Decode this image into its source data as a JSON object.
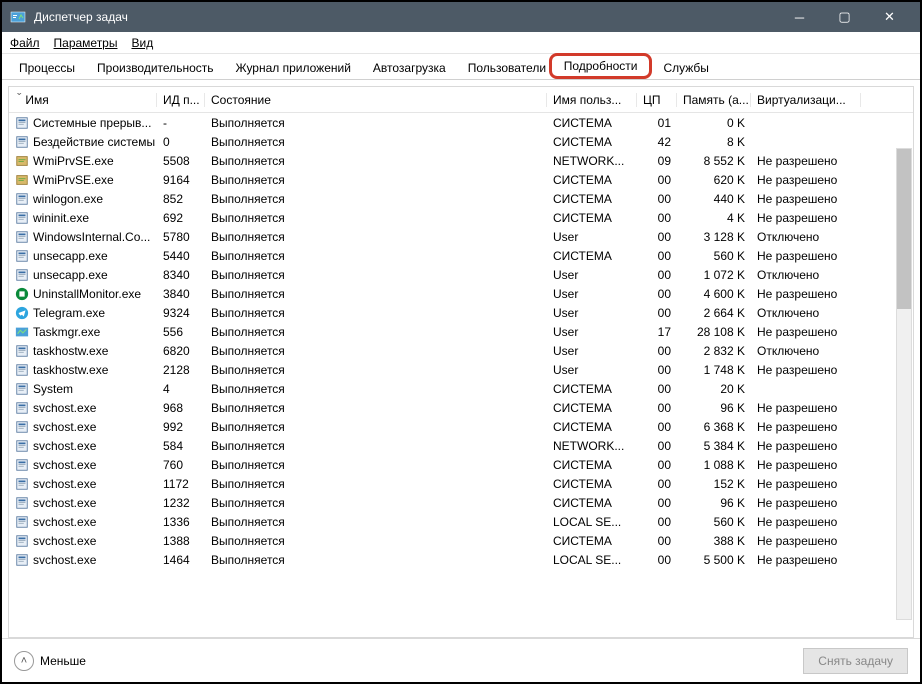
{
  "titlebar": {
    "title": "Диспетчер задач"
  },
  "menubar": {
    "file": "Файл",
    "options": "Параметры",
    "view": "Вид"
  },
  "tabs": {
    "processes": "Процессы",
    "performance": "Производительность",
    "apphistory": "Журнал приложений",
    "startup": "Автозагрузка",
    "users": "Пользователи",
    "details": "Подробности",
    "services": "Службы"
  },
  "columns": {
    "name": "Имя",
    "pid": "ИД п...",
    "state": "Состояние",
    "user": "Имя польз...",
    "cpu": "ЦП",
    "mem": "Память (а...",
    "virt": "Виртуализаци..."
  },
  "state_running": "Выполняется",
  "rows": [
    {
      "name": "Системные прерыв...",
      "pid": "-",
      "user": "СИСТЕМА",
      "cpu": "01",
      "mem": "0 K",
      "virt": "",
      "icon": "sys"
    },
    {
      "name": "Бездействие системы",
      "pid": "0",
      "user": "СИСТЕМА",
      "cpu": "42",
      "mem": "8 K",
      "virt": "",
      "icon": "sys"
    },
    {
      "name": "WmiPrvSE.exe",
      "pid": "5508",
      "user": "NETWORK...",
      "cpu": "09",
      "mem": "8 552 K",
      "virt": "Не разрешено",
      "icon": "wmi"
    },
    {
      "name": "WmiPrvSE.exe",
      "pid": "9164",
      "user": "СИСТЕМА",
      "cpu": "00",
      "mem": "620 K",
      "virt": "Не разрешено",
      "icon": "wmi"
    },
    {
      "name": "winlogon.exe",
      "pid": "852",
      "user": "СИСТЕМА",
      "cpu": "00",
      "mem": "440 K",
      "virt": "Не разрешено",
      "icon": "exe"
    },
    {
      "name": "wininit.exe",
      "pid": "692",
      "user": "СИСТЕМА",
      "cpu": "00",
      "mem": "4 K",
      "virt": "Не разрешено",
      "icon": "exe"
    },
    {
      "name": "WindowsInternal.Co...",
      "pid": "5780",
      "user": "User",
      "cpu": "00",
      "mem": "3 128 K",
      "virt": "Отключено",
      "icon": "exe"
    },
    {
      "name": "unsecapp.exe",
      "pid": "5440",
      "user": "СИСТЕМА",
      "cpu": "00",
      "mem": "560 K",
      "virt": "Не разрешено",
      "icon": "exe"
    },
    {
      "name": "unsecapp.exe",
      "pid": "8340",
      "user": "User",
      "cpu": "00",
      "mem": "1 072 K",
      "virt": "Отключено",
      "icon": "exe"
    },
    {
      "name": "UninstallMonitor.exe",
      "pid": "3840",
      "user": "User",
      "cpu": "00",
      "mem": "4 600 K",
      "virt": "Не разрешено",
      "icon": "green"
    },
    {
      "name": "Telegram.exe",
      "pid": "9324",
      "user": "User",
      "cpu": "00",
      "mem": "2 664 K",
      "virt": "Отключено",
      "icon": "telegram"
    },
    {
      "name": "Taskmgr.exe",
      "pid": "556",
      "user": "User",
      "cpu": "17",
      "mem": "28 108 K",
      "virt": "Не разрешено",
      "icon": "taskmgr"
    },
    {
      "name": "taskhostw.exe",
      "pid": "6820",
      "user": "User",
      "cpu": "00",
      "mem": "2 832 K",
      "virt": "Отключено",
      "icon": "exe"
    },
    {
      "name": "taskhostw.exe",
      "pid": "2128",
      "user": "User",
      "cpu": "00",
      "mem": "1 748 K",
      "virt": "Не разрешено",
      "icon": "exe"
    },
    {
      "name": "System",
      "pid": "4",
      "user": "СИСТЕМА",
      "cpu": "00",
      "mem": "20 K",
      "virt": "",
      "icon": "sys"
    },
    {
      "name": "svchost.exe",
      "pid": "968",
      "user": "СИСТЕМА",
      "cpu": "00",
      "mem": "96 K",
      "virt": "Не разрешено",
      "icon": "svc"
    },
    {
      "name": "svchost.exe",
      "pid": "992",
      "user": "СИСТЕМА",
      "cpu": "00",
      "mem": "6 368 K",
      "virt": "Не разрешено",
      "icon": "svc"
    },
    {
      "name": "svchost.exe",
      "pid": "584",
      "user": "NETWORK...",
      "cpu": "00",
      "mem": "5 384 K",
      "virt": "Не разрешено",
      "icon": "svc"
    },
    {
      "name": "svchost.exe",
      "pid": "760",
      "user": "СИСТЕМА",
      "cpu": "00",
      "mem": "1 088 K",
      "virt": "Не разрешено",
      "icon": "svc"
    },
    {
      "name": "svchost.exe",
      "pid": "1172",
      "user": "СИСТЕМА",
      "cpu": "00",
      "mem": "152 K",
      "virt": "Не разрешено",
      "icon": "svc"
    },
    {
      "name": "svchost.exe",
      "pid": "1232",
      "user": "СИСТЕМА",
      "cpu": "00",
      "mem": "96 K",
      "virt": "Не разрешено",
      "icon": "svc"
    },
    {
      "name": "svchost.exe",
      "pid": "1336",
      "user": "LOCAL SE...",
      "cpu": "00",
      "mem": "560 K",
      "virt": "Не разрешено",
      "icon": "svc"
    },
    {
      "name": "svchost.exe",
      "pid": "1388",
      "user": "СИСТЕМА",
      "cpu": "00",
      "mem": "388 K",
      "virt": "Не разрешено",
      "icon": "svc"
    },
    {
      "name": "svchost.exe",
      "pid": "1464",
      "user": "LOCAL SE...",
      "cpu": "00",
      "mem": "5 500 K",
      "virt": "Не разрешено",
      "icon": "svc"
    }
  ],
  "footer": {
    "less": "Меньше",
    "endtask": "Снять задачу"
  }
}
